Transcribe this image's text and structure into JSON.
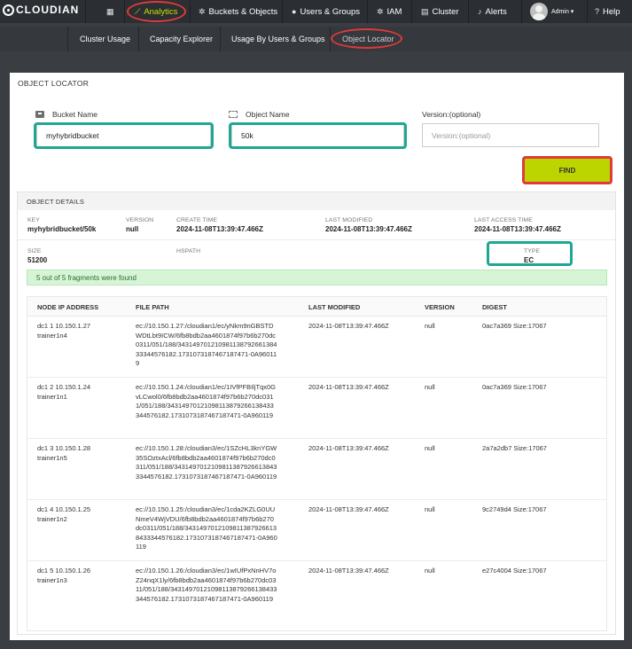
{
  "topnav": {
    "logo": "CLOUDIAN",
    "items": [
      {
        "label": "",
        "icon": "grid-icon"
      },
      {
        "label": "Analytics",
        "icon": "chart-icon"
      },
      {
        "label": "Buckets & Objects",
        "icon": "gear-icon"
      },
      {
        "label": "Users & Groups",
        "icon": "users-icon"
      },
      {
        "label": "IAM",
        "icon": "gear-icon"
      },
      {
        "label": "Cluster",
        "icon": "server-icon"
      },
      {
        "label": "Alerts",
        "icon": "bell-icon"
      },
      {
        "label": "Admin ▾",
        "icon": "avatar"
      },
      {
        "label": "Help",
        "icon": "help-icon"
      }
    ]
  },
  "subnav": {
    "items": [
      "Cluster Usage",
      "Capacity Explorer",
      "Usage By Users & Groups",
      "Object Locator"
    ]
  },
  "panel": {
    "title": "OBJECT LOCATOR",
    "bucket_label": "Bucket Name",
    "bucket_value": "myhybridbucket",
    "object_label": "Object Name",
    "object_value": "50k",
    "version_label": "Version:(optional)",
    "version_placeholder": "Version:(optional)",
    "find_label": "FIND"
  },
  "details": {
    "title": "OBJECT DETAILS",
    "key_label": "KEY",
    "key_value": "myhybridbucket/50k",
    "version_label": "VERSION",
    "version_value": "null",
    "create_label": "CREATE TIME",
    "create_value": "2024-11-08T13:39:47.466Z",
    "modified_label": "LAST MODIFIED",
    "modified_value": "2024-11-08T13:39:47.466Z",
    "access_label": "LAST ACCESS TIME",
    "access_value": "2024-11-08T13:39:47.466Z",
    "size_label": "SIZE",
    "size_value": "51200",
    "hspath_label": "HSPATH",
    "type_label": "TYPE",
    "type_value": "EC",
    "alert": "5 out of 5 fragments were found"
  },
  "table": {
    "headers": [
      "NODE IP ADDRESS",
      "FILE PATH",
      "LAST MODIFIED",
      "VERSION",
      "DIGEST"
    ],
    "rows": [
      {
        "node": "dc1 1 10.150.1.27 trainer1n4",
        "path": "ec://10.150.1.27:/cloudian1/ec/yNkm9nGBSTDWDtLbt9ICW/6fb8bdb2aa4601874f97b6b270dc0311/051/188/34314970121098113879266138433344576182.1731073187467187471-0A960119",
        "modified": "2024-11-08T13:39:47.466Z",
        "version": "null",
        "digest": "0ac7a369 Size:17067"
      },
      {
        "node": "dc1 2 10.150.1.24 trainer1n1",
        "path": "ec://10.150.1.24:/cloudian1/ec/1IVfPFBIljTqx0GvLCwol0/6fb8bdb2aa4601874f97b6b270dc0311/051/188/34314970121098113879266138433344576182.1731073187467187471-0A960119",
        "modified": "2024-11-08T13:39:47.466Z",
        "version": "null",
        "digest": "0ac7a369 Size:17067"
      },
      {
        "node": "dc1 3 10.150.1.28 trainer1n5",
        "path": "ec://10.150.1.28:/cloudian3/ec/1SZcHL3knYGW35SOztxAcl/6fb8bdb2aa4601874f97b6b270dc0311/051/188/34314970121098113879266138433344576182.1731073187467187471-0A960119",
        "modified": "2024-11-08T13:39:47.466Z",
        "version": "null",
        "digest": "2a7a2db7 Size:17067"
      },
      {
        "node": "dc1 4 10.150.1.25 trainer1n2",
        "path": "ec://10.150.1.25:/cloudian3/ec/1cda2KZLG0UUNmeV4WjVDU/6fb8bdb2aa4601874f97b6b270dc0311/051/188/34314970121098113879266138433344576182.1731073187467187471-0A960119",
        "modified": "2024-11-08T13:39:47.466Z",
        "version": "null",
        "digest": "9c2749d4 Size:17067"
      },
      {
        "node": "dc1 5 10.150.1.26 trainer1n3",
        "path": "ec://10.150.1.26:/cloudian3/ec/1wIUfPxNnHV7oZ24nqX1ly/6fb8bdb2aa4601874f97b6b270dc0311/051/188/34314970121098113879266138433344576182.1731073187467187471-0A960119",
        "modified": "2024-11-08T13:39:47.466Z",
        "version": "null",
        "digest": "e27c4004 Size:17067"
      }
    ]
  },
  "colors": {
    "accent": "#c8e000",
    "highlight_red": "#e03a3a",
    "highlight_teal": "#1fa793"
  }
}
